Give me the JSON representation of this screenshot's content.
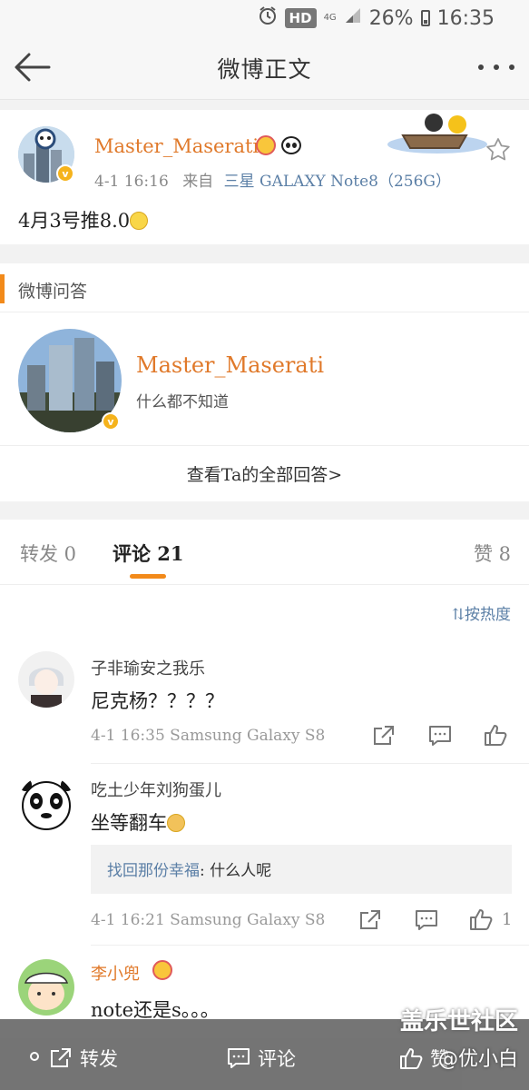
{
  "status_bar": {
    "hd": "HD",
    "network": "4G",
    "battery": "26%",
    "time": "16:35"
  },
  "nav": {
    "title": "微博正文"
  },
  "post": {
    "author": "Master_Maserati",
    "time": "4-1 16:16",
    "from_label": "来自",
    "source": "三星 GALAXY Note8（256G）",
    "text": "4月3号推8.0"
  },
  "qa": {
    "section_title": "微博问答",
    "user_name": "Master_Maserati",
    "user_bio": "什么都不知道",
    "view_all": "查看Ta的全部回答>"
  },
  "tabs": {
    "repost": "转发 0",
    "comment": "评论 21",
    "like": "赞 8"
  },
  "sort_label": "按热度",
  "comments": [
    {
      "name": "子非瑜安之我乐",
      "text": "尼克杨？？？？",
      "meta": "4-1 16:35 Samsung Galaxy S8",
      "likes": ""
    },
    {
      "name": "吃土少年刘狗蛋儿",
      "text": "坐等翻车",
      "reply_user": "找回那份幸福",
      "reply_text": ": 什么人呢",
      "meta": "4-1 16:21 Samsung Galaxy S8",
      "likes": "1"
    },
    {
      "name": "李小兜",
      "text": "note还是s。。。"
    }
  ],
  "bottom_bar": {
    "repost": "转发",
    "comment": "评论",
    "like": "赞"
  },
  "watermark": {
    "line1": "盖乐世社区",
    "line2": "@优小白"
  },
  "colors": {
    "accent": "#f28a1a",
    "name_orange": "#e0792a",
    "link_blue": "#5b7fa6"
  }
}
